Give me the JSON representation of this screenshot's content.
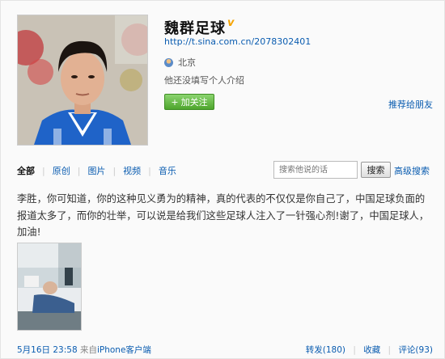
{
  "profile": {
    "name": "魏群足球",
    "verified_mark": "v",
    "url": "http://t.sina.com.cn/2078302401",
    "location": "北京",
    "bio": "他还没填写个人介绍",
    "follow_label": "加关注",
    "follow_icon": "+",
    "recommend_label": "推荐给朋友"
  },
  "tabs": [
    "全部",
    "原创",
    "图片",
    "视频",
    "音乐"
  ],
  "search": {
    "placeholder": "搜索他说的话",
    "button_label": "搜索",
    "advanced_label": "高级搜索"
  },
  "post": {
    "text": "李胜，你可知道，你的这种见义勇为的精神，真的代表的不仅仅是你自己了，中国足球负面的报道太多了，而你的壮举，可以说是给我们这些足球人注入了一针强心剂!谢了，中国足球人，加油!",
    "time": "5月16日 23:58",
    "source_prefix": "来自",
    "source": "iPhone客户端",
    "repost_label": "转发(180)",
    "favorite_label": "收藏",
    "comment_label": "评论(93)"
  },
  "colors": {
    "link": "#0a5cb0",
    "follow_button": "#4ea52d",
    "verified": "#f5a300"
  },
  "icons": {
    "location": "location-person-icon",
    "verified": "verified-v-icon",
    "follow_plus": "plus-icon"
  }
}
